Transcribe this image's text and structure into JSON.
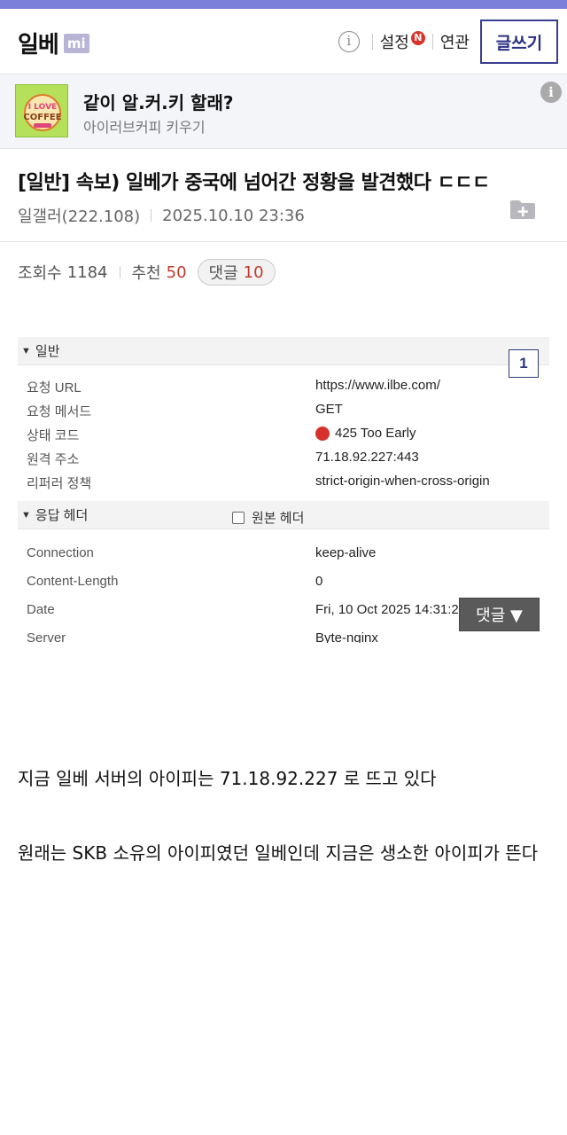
{
  "colors": {
    "accent_bar": "#7b7fd9",
    "write_button": "#2b3080",
    "highlight_red": "#c0392b"
  },
  "header": {
    "logo": "일베",
    "logo_badge": "mi",
    "info_icon_glyph": "i",
    "settings_label": "설정",
    "settings_badge": "N",
    "related_label": "연관",
    "write_label": "글쓰기"
  },
  "ad": {
    "title": "같이 알.커.키 할래?",
    "subtitle": "아이러브커피 키우기",
    "thumb_text": "I LOVE COFFEE",
    "info_glyph": "i"
  },
  "post": {
    "title": "[일반] 속보) 일베가 중국에 넘어간 정황을 발견했다 ㄷㄷㄷ",
    "author": "일갤러(222.108)",
    "datetime": "2025.10.10 23:36"
  },
  "stats": {
    "views_label": "조회수",
    "views": "1184",
    "recommend_label": "추천",
    "recommend": "50",
    "comments_label": "댓글",
    "comments": "10"
  },
  "devtools": {
    "general_header": "일반",
    "general": [
      {
        "key": "요청 URL",
        "value": "https://www.ilbe.com/"
      },
      {
        "key": "요청 메서드",
        "value": "GET"
      },
      {
        "key": "상태 코드",
        "value": "425 Too Early"
      },
      {
        "key": "원격 주소",
        "value": "71.18.92.227:443"
      },
      {
        "key": "리퍼러 정책",
        "value": "strict-origin-when-cross-origin"
      }
    ],
    "response_header": "응답 헤더",
    "raw_header_label": "원본 헤더",
    "response": [
      {
        "key": "Connection",
        "value": "keep-alive"
      },
      {
        "key": "Content-Length",
        "value": "0"
      },
      {
        "key": "Date",
        "value": "Fri, 10 Oct 2025 14:31:21 GMT"
      },
      {
        "key": "Server",
        "value": "Byte-nginx"
      }
    ],
    "badge_number": "1"
  },
  "comment_button": "댓글 ▼",
  "body": {
    "line1": "지금 일베 서버의 아이피는 71.18.92.227 로 뜨고 있다",
    "line2": "원래는 SKB 소유의 아이피였던 일베인데 지금은 생소한 아이피가 뜬다"
  }
}
